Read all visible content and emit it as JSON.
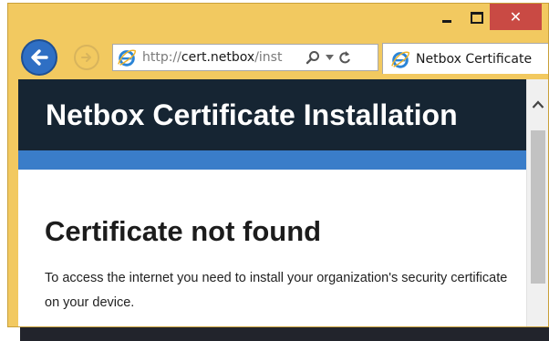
{
  "window": {
    "minimize_icon": "minimize-icon",
    "maximize_icon": "maximize-icon",
    "close_glyph": "✕",
    "frame_color": "#f2c960",
    "close_color": "#c94a44"
  },
  "nav": {
    "back_icon": "back-arrow-icon",
    "forward_icon": "forward-arrow-icon",
    "address": {
      "scheme": "http://",
      "host": "cert.netbox",
      "path": "/inst"
    },
    "search_icon": "search-icon",
    "dropdown_icon": "chevron-down-icon",
    "refresh_icon": "refresh-icon"
  },
  "tab": {
    "icon": "ie-logo-icon",
    "label": "Netbox Certificate"
  },
  "page": {
    "header_title": "Netbox Certificate Installation",
    "header_color": "#162533",
    "accent_color": "#3a7dc9",
    "heading": "Certificate not found",
    "body": "To access the internet you need to install your organization's security certificate on your device."
  },
  "scrollbar": {
    "up_icon": "scroll-up-arrow-icon"
  }
}
